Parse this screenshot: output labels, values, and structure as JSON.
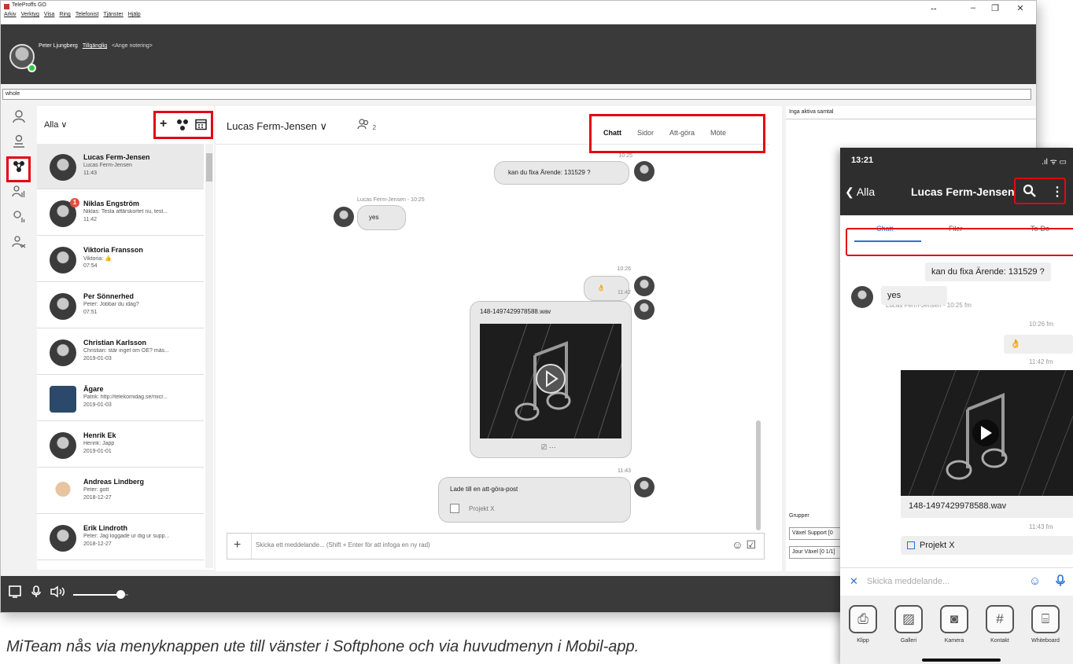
{
  "app": {
    "title": "TeleProffs GO",
    "menu": [
      "Arkiv",
      "Verktyg",
      "Visa",
      "Ring",
      "Telefonist",
      "Tjänster",
      "Hjälp"
    ],
    "window_controls": {
      "resize": "↔",
      "minimize": "–",
      "restore": "❐",
      "close": "✕"
    }
  },
  "user": {
    "name": "Peter Ljungberg",
    "status": "Tillgänglig",
    "note_placeholder": "<Ange notering>",
    "presence_color": "#2ecc40"
  },
  "search": {
    "value": "whole"
  },
  "rail": {
    "icons": [
      "person-icon",
      "person-hands-icon",
      "miteam-icon",
      "group-call-icon",
      "queue-icon",
      "forward-icon"
    ]
  },
  "contact_list": {
    "filter": "Alla",
    "filter_chevron": "∨",
    "tools": {
      "add": "+",
      "team": "⁂",
      "calendar": "▦"
    },
    "contacts": [
      {
        "name": "Lucas Ferm-Jensen",
        "preview": "Lucas Ferm-Jensen",
        "time": "11:43"
      },
      {
        "name": "Niklas Engström",
        "preview": "Niklas: Testa affärskortet nu, test...",
        "time": "11:42",
        "badge": "1"
      },
      {
        "name": "Viktoria Fransson",
        "preview": "Viktoria: 👍",
        "time": "07:54"
      },
      {
        "name": "Per Sönnerhed",
        "preview": "Peter: Jobbar du idag?",
        "time": "07:51"
      },
      {
        "name": "Christian Karlsson",
        "preview": "Christian: står inget om OE? mås...",
        "time": "2019-01-03"
      },
      {
        "name": "Ägare",
        "preview": "Patrik: http://telekomidag.se/micr...",
        "time": "2019-01-03"
      },
      {
        "name": "Henrik Ek",
        "preview": "Henrik: Japp",
        "time": "2019-01-01"
      },
      {
        "name": "Andreas Lindberg",
        "preview": "Peter: gott",
        "time": "2018-12-27"
      },
      {
        "name": "Erik Lindroth",
        "preview": "Peter: Jag loggade ur dig ur supp...",
        "time": "2018-12-27"
      }
    ]
  },
  "chat": {
    "title": "Lucas Ferm-Jensen",
    "title_chevron": "∨",
    "members_count": "2",
    "tabs": [
      "Chatt",
      "Sidor",
      "Att-göra",
      "Möte"
    ],
    "active_tab": "Chatt",
    "messages": {
      "m1_time": "10:25",
      "m1_text": "kan du fixa Ärende: 131529 ?",
      "m2_sender": "Lucas Ferm-Jensen - 10:25",
      "m2_text": "yes",
      "m3_time": "10:26",
      "m3_text": "👌",
      "m4_time": "11:42",
      "m4_file": "148-1497429978588.wav",
      "m4_actions": "⎚   ···",
      "m5_time": "11:43",
      "m5_text": "Lade till en att-göra-post",
      "m5_task": "Projekt X"
    },
    "composer_placeholder": "Skicka ett meddelande... (Shift + Enter för att infoga en ny rad)",
    "composer_plus": "+",
    "composer_icons": "☺ ☑"
  },
  "right_panel": {
    "no_calls": "Inga aktiva samtal",
    "groups_label": "Grupper",
    "groups": [
      "Växel Support [0",
      "Jour Växel [0 1/1]"
    ]
  },
  "bottom_bar": {
    "icons": [
      "screen-icon",
      "mic-icon",
      "speaker-icon"
    ],
    "volume": 0.85
  },
  "caption": "MiTeam nås via menyknappen ute till vänster i Softphone och via huvudmenyn i Mobil-app.",
  "phone": {
    "time": "13:21",
    "status_icons": ".ıl ᯤ ▭",
    "back": "❮ Alla",
    "title": "Lucas Ferm-Jensen",
    "search_icon": "🔍",
    "more_icon": "⋮",
    "tabs": [
      "Chatt",
      "Filer",
      "To-Do"
    ],
    "active_tab": "Chatt",
    "messages": {
      "m1_text": "kan du fixa Ärende: 131529 ?",
      "m2_sender": "Lucas Ferm-Jensen - 10:25 fm",
      "m2_text": "yes",
      "m3_time": "10:26 fm",
      "m3_text": "👌",
      "m4_time": "11:42 fm",
      "m4_file": "148-1497429978588.wav",
      "m5_time": "11:43 fm",
      "m5_task": "Projekt X"
    },
    "composer_placeholder": "Skicka meddelande...",
    "composer_close": "✕",
    "emoji_icon": "☺",
    "mic_icon": "🎙",
    "tools": [
      {
        "label": "Klipp",
        "glyph": "⎙"
      },
      {
        "label": "Galleri",
        "glyph": "▨"
      },
      {
        "label": "Kamera",
        "glyph": "◙"
      },
      {
        "label": "Kontakt",
        "glyph": "#"
      },
      {
        "label": "Whiteboard",
        "glyph": "⌸"
      }
    ]
  },
  "accent_colors": {
    "highlight": "#e30613",
    "mobile_accent": "#2d6fd6"
  }
}
